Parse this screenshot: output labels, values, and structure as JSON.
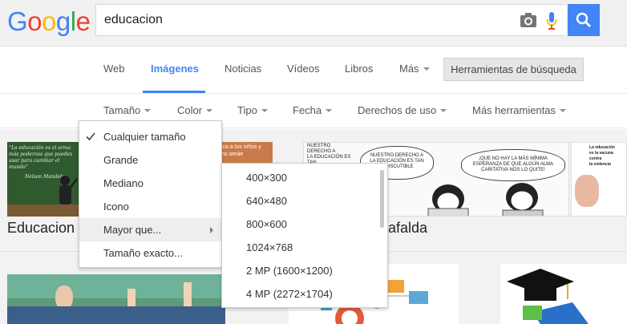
{
  "header": {
    "logo_letters": [
      {
        "ch": "G",
        "color": "#4285f4"
      },
      {
        "ch": "o",
        "color": "#ea4335"
      },
      {
        "ch": "o",
        "color": "#fbbc05"
      },
      {
        "ch": "g",
        "color": "#4285f4"
      },
      {
        "ch": "l",
        "color": "#34a853"
      },
      {
        "ch": "e",
        "color": "#ea4335"
      }
    ],
    "search_value": "educacion",
    "icons": [
      "camera-icon",
      "microphone-icon",
      "search-icon"
    ],
    "accent": "#4285f4"
  },
  "tabs": {
    "items": [
      "Web",
      "Imágenes",
      "Noticias",
      "Vídeos",
      "Libros",
      "Más"
    ],
    "active": "Imágenes",
    "tools_label": "Herramientas de búsqueda"
  },
  "filters": [
    "Tamaño",
    "Color",
    "Tipo",
    "Fecha",
    "Derechos de uso",
    "Más herramientas"
  ],
  "size_menu": {
    "items": [
      "Cualquier tamaño",
      "Grande",
      "Mediano",
      "Icono",
      "Mayor que...",
      "Tamaño exacto..."
    ],
    "selected": "Cualquier tamaño",
    "highlighted": "Mayor que..."
  },
  "size_submenu": {
    "items": [
      "400×300",
      "640×480",
      "800×600",
      "1024×768",
      "2 MP (1600×1200)",
      "4 MP (2272×1704)"
    ]
  },
  "results": {
    "row1_titles": [
      "Educacion",
      "afalda"
    ],
    "thumb1_text": [
      "“La educación es el arma",
      "más poderosa que puedes",
      "usar para cambiar el",
      "mundo”",
      "Nelson Mandela"
    ],
    "thumb2_text": [
      "ica a los niños y",
      "no seráe"
    ],
    "comic_text": [
      "NUESTRO DERECHO A",
      "LA EDUCACIÓN ES TAN",
      "INDISCUTIBLE",
      "¡QUE NO HAY LA MÁS MÍNIMA",
      "ESPERANZA DE QUE ALGÚN ALMA",
      "CARITATIVA NOS LO QUITE!",
      "La educación",
      "es la vacuna",
      "contra",
      "la violencia"
    ]
  }
}
